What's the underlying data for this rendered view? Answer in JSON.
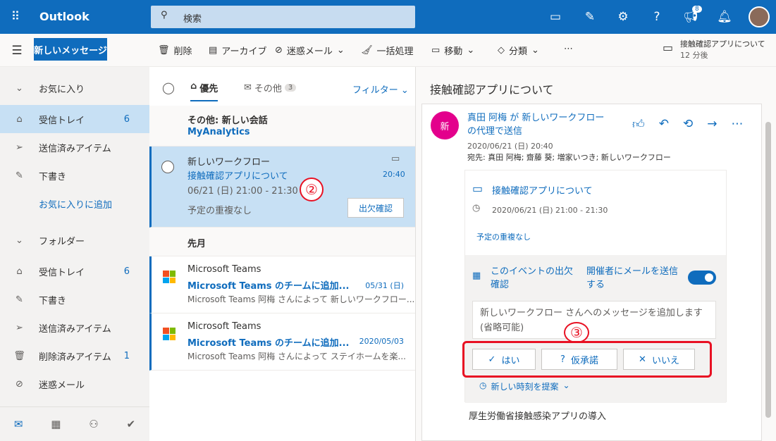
{
  "app": {
    "title": "Outlook",
    "search_placeholder": "検索",
    "notification_count": "8"
  },
  "toolbar": {
    "new_message": "新しいメッセージ",
    "delete": "削除",
    "archive": "アーカイブ",
    "junk": "迷惑メール",
    "sweep": "一括処理",
    "move": "移動",
    "categorize": "分類",
    "more": "⋯",
    "reminder_title": "接触確認アプリについて",
    "reminder_time": "12 分後"
  },
  "nav": {
    "favorites": "お気に入り",
    "inbox": "受信トレイ",
    "inbox_count": "6",
    "sent": "送信済みアイテム",
    "drafts": "下書き",
    "add_favorite": "お気に入りに追加",
    "folders": "フォルダー",
    "f_inbox": "受信トレイ",
    "f_inbox_count": "6",
    "f_drafts": "下書き",
    "f_sent": "送信済みアイテム",
    "f_deleted": "削除済みアイテム",
    "f_deleted_count": "1",
    "f_junk": "迷惑メール"
  },
  "list": {
    "tab_focused": "優先",
    "tab_other": "その他",
    "other_count": "3",
    "filter": "フィルター",
    "other_new_title": "その他: 新しい会話",
    "other_new_sender": "MyAnalytics",
    "selected": {
      "sender": "新しいワークフロー",
      "subject": "接触確認アプリについて",
      "time": "20:40",
      "when": "06/21 (日) 21:00 - 21:30",
      "conflict": "予定の重複なし",
      "rsvp": "出欠確認",
      "marker": "②"
    },
    "group_last_month": "先月",
    "items": [
      {
        "sender": "Microsoft Teams",
        "subject": "Microsoft Teams のチームに追加...",
        "date": "05/31 (日)",
        "preview": "Microsoft Teams 阿梅 さんによって 新しいワークフロー..."
      },
      {
        "sender": "Microsoft Teams",
        "subject": "Microsoft Teams のチームに追加...",
        "date": "2020/05/03",
        "preview": "Microsoft Teams 阿梅 さんによって ステイホームを楽..."
      }
    ]
  },
  "reading": {
    "title": "接触確認アプリについて",
    "avatar": "新",
    "from": "真田 阿梅 が 新しいワークフロー の代理で送信",
    "date": "2020/06/21 (日) 20:40",
    "to_label": "宛先:",
    "to": "真田 阿梅; 齋藤 葵; 増家いつき; 新しいワークフロー",
    "event_title": "接触確認アプリについて",
    "event_time": "2020/06/21 (日) 21:00 - 21:30",
    "conflict": "予定の重複なし",
    "rsvp_label": "このイベントの出欠確認",
    "send_email_label": "開催者にメールを送信する",
    "send_email_on": true,
    "message_placeholder": "新しいワークフロー さんへのメッセージを追加します (省略可能)",
    "marker": "③",
    "yes": "はい",
    "tentative": "仮承諾",
    "no": "いいえ",
    "propose": "新しい時刻を提案",
    "body": "厚生労働省接触感染アプリの導入"
  },
  "colors": {
    "brand": "#0f6cbd",
    "avatar": "#e3008c",
    "highlight": "#e81123"
  }
}
